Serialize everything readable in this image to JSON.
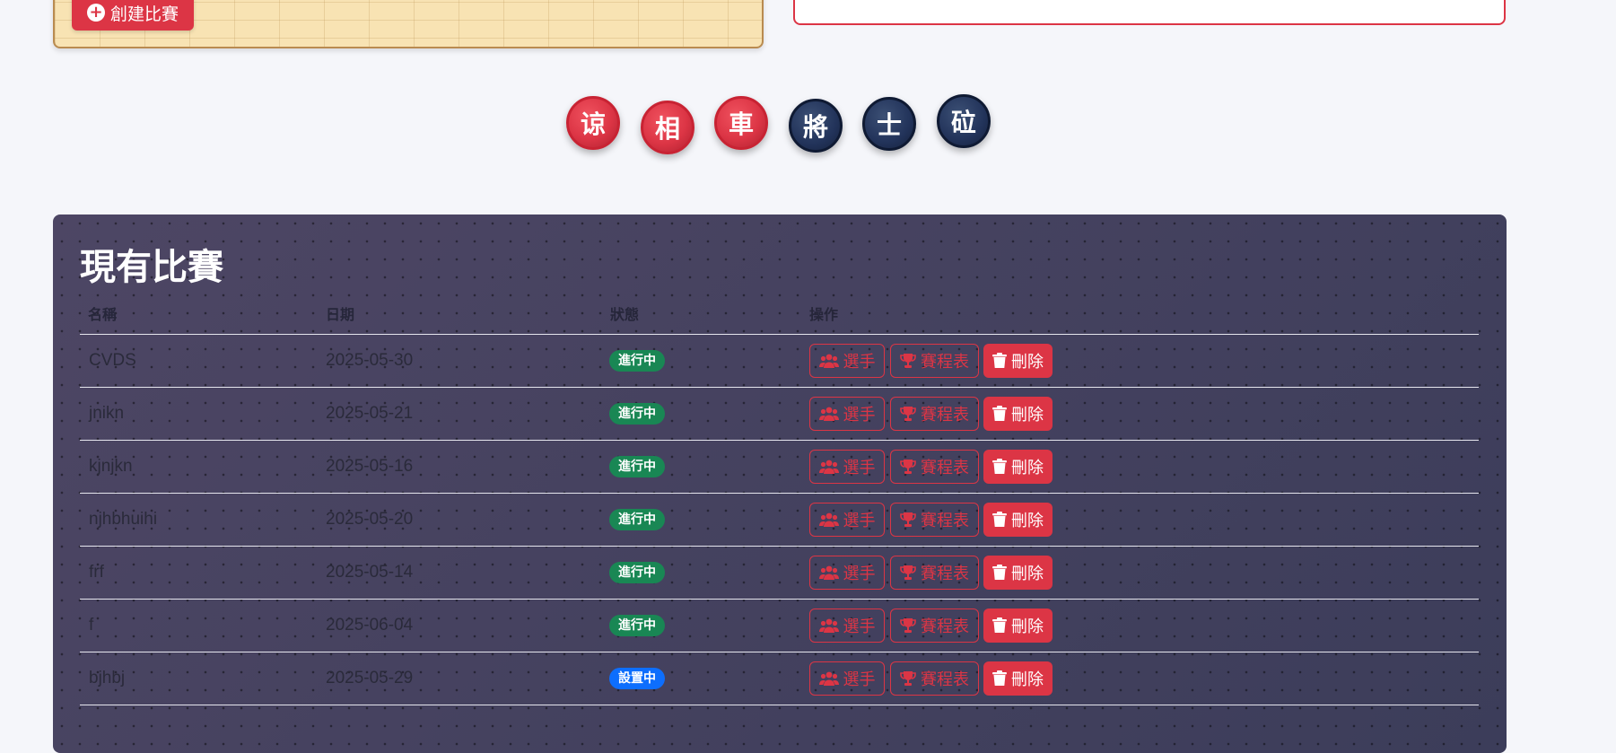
{
  "create_panel": {
    "button_label": "創建比賽"
  },
  "pieces": [
    {
      "char": "谅",
      "color": "red"
    },
    {
      "char": "相",
      "color": "red"
    },
    {
      "char": "車",
      "color": "red"
    },
    {
      "char": "將",
      "color": "dark"
    },
    {
      "char": "士",
      "color": "dark"
    },
    {
      "char": "砬",
      "color": "dark"
    }
  ],
  "tournaments": {
    "title": "現有比賽",
    "headers": {
      "name": "名稱",
      "date": "日期",
      "status": "狀態",
      "actions": "操作"
    },
    "actions": {
      "players": "選手",
      "schedule": "賽程表",
      "delete": "刪除"
    },
    "rows": [
      {
        "name": "CVDS",
        "date": "2025-05-30",
        "status": "進行中",
        "status_type": "active"
      },
      {
        "name": "jnikn",
        "date": "2025-05-21",
        "status": "進行中",
        "status_type": "active"
      },
      {
        "name": "kjnjkn",
        "date": "2025-05-16",
        "status": "進行中",
        "status_type": "active"
      },
      {
        "name": "njhbhuihi",
        "date": "2025-05-20",
        "status": "進行中",
        "status_type": "active"
      },
      {
        "name": "frf",
        "date": "2025-05-14",
        "status": "進行中",
        "status_type": "active"
      },
      {
        "name": "f",
        "date": "2025-06-04",
        "status": "進行中",
        "status_type": "active"
      },
      {
        "name": "bjhbj",
        "date": "2025-05-29",
        "status": "設置中",
        "status_type": "setup"
      }
    ]
  },
  "colors": {
    "accent_red": "#dc3545",
    "status_active": "#198754",
    "status_setup": "#0d6efd",
    "piece_dark": "#22335a"
  }
}
